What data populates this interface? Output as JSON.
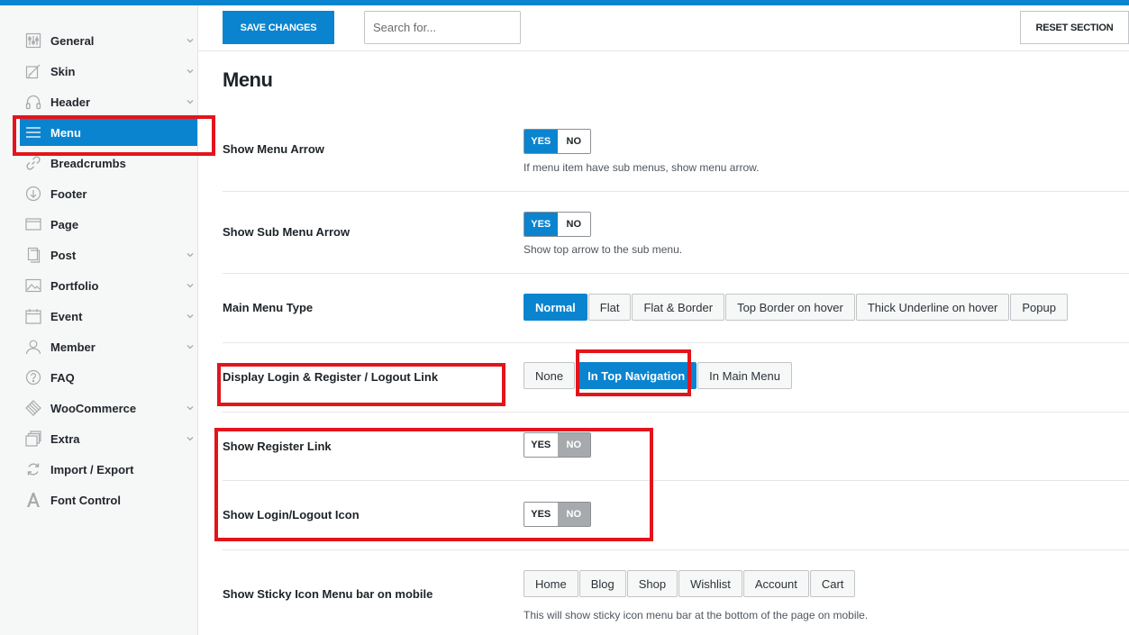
{
  "toolbar": {
    "save_label": "SAVE CHANGES",
    "search_placeholder": "Search for...",
    "reset_label": "RESET SECTION"
  },
  "sidebar": {
    "items": [
      {
        "label": "General",
        "icon": "sliders-icon",
        "has_children": true
      },
      {
        "label": "Skin",
        "icon": "brush-icon",
        "has_children": true
      },
      {
        "label": "Header",
        "icon": "headphones-icon",
        "has_children": true
      },
      {
        "label": "Menu",
        "icon": "menu-icon",
        "has_children": false,
        "active": true
      },
      {
        "label": "Breadcrumbs",
        "icon": "link-icon",
        "has_children": false
      },
      {
        "label": "Footer",
        "icon": "arrow-down-circle-icon",
        "has_children": false
      },
      {
        "label": "Page",
        "icon": "window-icon",
        "has_children": false
      },
      {
        "label": "Post",
        "icon": "copy-icon",
        "has_children": true
      },
      {
        "label": "Portfolio",
        "icon": "image-icon",
        "has_children": true
      },
      {
        "label": "Event",
        "icon": "calendar-icon",
        "has_children": true
      },
      {
        "label": "Member",
        "icon": "user-icon",
        "has_children": true
      },
      {
        "label": "FAQ",
        "icon": "question-icon",
        "has_children": false
      },
      {
        "label": "WooCommerce",
        "icon": "woo-icon",
        "has_children": true
      },
      {
        "label": "Extra",
        "icon": "layers-icon",
        "has_children": true
      },
      {
        "label": "Import / Export",
        "icon": "refresh-icon",
        "has_children": false
      },
      {
        "label": "Font Control",
        "icon": "font-icon",
        "has_children": false
      }
    ]
  },
  "section": {
    "title": "Menu"
  },
  "settings": {
    "show_menu_arrow": {
      "label": "Show Menu Arrow",
      "yes": "YES",
      "no": "NO",
      "value": "YES",
      "description": "If menu item have sub menus, show menu arrow."
    },
    "show_sub_menu_arrow": {
      "label": "Show Sub Menu Arrow",
      "yes": "YES",
      "no": "NO",
      "value": "YES",
      "description": "Show top arrow to the sub menu."
    },
    "main_menu_type": {
      "label": "Main Menu Type",
      "options": [
        "Normal",
        "Flat",
        "Flat & Border",
        "Top Border on hover",
        "Thick Underline on hover",
        "Popup"
      ],
      "selected": "Normal"
    },
    "display_login": {
      "label": "Display Login & Register / Logout Link",
      "options": [
        "None",
        "In Top Navigation",
        "In Main Menu"
      ],
      "selected": "In Top Navigation"
    },
    "show_register_link": {
      "label": "Show Register Link",
      "yes": "YES",
      "no": "NO",
      "value": "NO"
    },
    "show_login_icon": {
      "label": "Show Login/Logout Icon",
      "yes": "YES",
      "no": "NO",
      "value": "NO"
    },
    "sticky_icon_menu": {
      "label": "Show Sticky Icon Menu bar on mobile",
      "options": [
        "Home",
        "Blog",
        "Shop",
        "Wishlist",
        "Account",
        "Cart"
      ],
      "description": "This will show sticky icon menu bar at the bottom of the page on mobile."
    }
  },
  "colors": {
    "accent": "#0a84cf",
    "highlight": "#e3141c"
  }
}
